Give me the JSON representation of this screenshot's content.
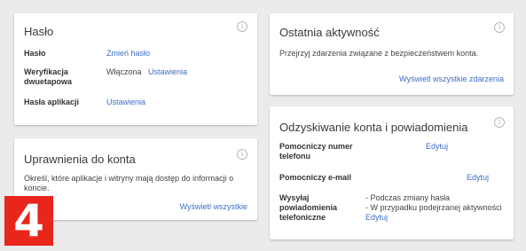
{
  "password_card": {
    "title": "Hasło",
    "rows": [
      {
        "label": "Hasło",
        "link": "Zmień hasło"
      },
      {
        "label": "Weryfikacja dwuetapowa",
        "status": "Włączona",
        "link": "Ustawienia"
      },
      {
        "label": "Hasła aplikacji",
        "link": "Ustawienia"
      }
    ]
  },
  "permissions_card": {
    "title": "Uprawnienia do konta",
    "description": "Określ, które aplikacje i witryny mają dostęp do informacji o koncie.",
    "link": "Wyświetl wszystkie"
  },
  "activity_card": {
    "title": "Ostatnia aktywność",
    "description": "Przejrzyj zdarzenia związane z bezpieczeństwem konta.",
    "link": "Wyświetl wszystkie zdarzenia"
  },
  "recovery_card": {
    "title": "Odzyskiwanie konta i powiadomienia",
    "rows": [
      {
        "label": "Pomocniczy numer telefonu",
        "link": "Edytuj"
      },
      {
        "label": "Pomocniczy e-mail",
        "link": "Edytuj"
      },
      {
        "label": "Wysyłaj powiadomienia telefoniczne",
        "items": [
          "- Podczas zmiany hasła",
          "- W przypadku podejrzanej aktywności"
        ],
        "link": "Edytuj"
      }
    ]
  },
  "info_icon_glyph": "i",
  "badge": {
    "text": "4",
    "color": "#e8261c"
  },
  "colors": {
    "link": "#3d6ec9",
    "background": "#ebebeb"
  }
}
